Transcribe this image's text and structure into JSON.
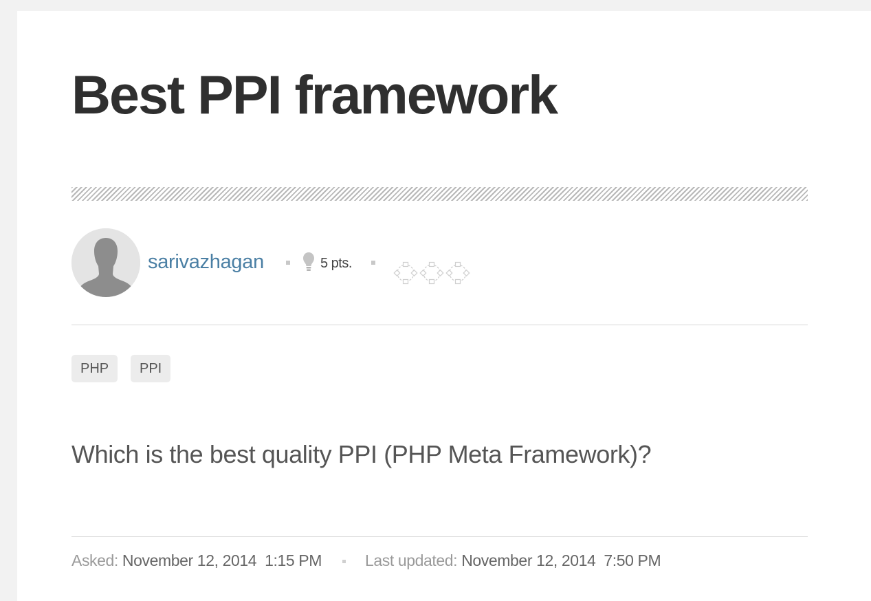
{
  "question": {
    "title": "Best PPI framework",
    "body": "Which is the best quality PPI (PHP Meta Framework)?"
  },
  "author": {
    "username": "sarivazhagan",
    "points": "5 pts.",
    "avatar_icon": "default-avatar-icon",
    "points_icon": "lightbulb-icon",
    "badges": [
      "badge-outline-icon",
      "badge-outline-icon",
      "badge-outline-icon"
    ]
  },
  "tags": [
    "PHP",
    "PPI"
  ],
  "meta": {
    "asked_label": "Asked:",
    "asked_value": "November 12, 2014  1:15 PM",
    "updated_label": "Last updated:",
    "updated_value": "November 12, 2014  7:50 PM"
  },
  "colors": {
    "username": "#4a7fa4",
    "title": "#2f2f2f",
    "page_background": "#f2f2f2",
    "tag_background": "#ececec"
  }
}
